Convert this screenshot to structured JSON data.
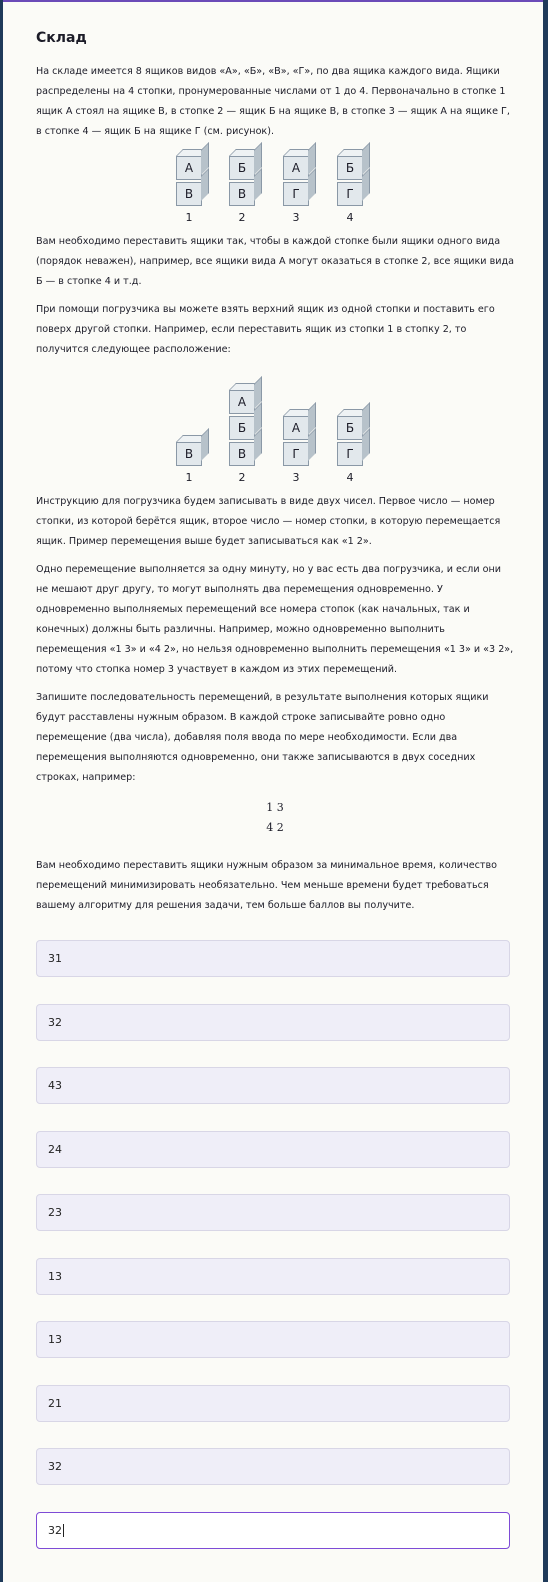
{
  "page": {
    "title": "Склад",
    "p1": "На складе имеется 8 ящиков видов «А», «Б», «В», «Г», по два ящика каждого вида. Ящики распределены на 4 стопки, пронумерованные числами от 1 до 4. Первоначально в стопке 1 ящик А стоял на ящике В, в стопке 2 — ящик Б на ящике В, в стопке 3 — ящик А на ящике Г, в стопке 4 — ящик Б на ящике Г (см. рисунок).",
    "p2": "Вам необходимо переставить ящики так, чтобы в каждой стопке были ящики одного вида (порядок неважен), например, все ящики вида А могут оказаться в стопке 2, все ящики вида Б — в стопке 4 и т.д.",
    "p3": "При помощи погрузчика вы можете взять верхний ящик из одной стопки и поставить его поверх другой стопки. Например, если переставить ящик из стопки 1 в стопку 2, то получится следующее расположение:",
    "p4": "Инструкцию для погрузчика будем записывать в виде двух чисел. Первое число — номер стопки, из которой берётся ящик, второе число — номер стопки, в которую перемещается ящик. Пример перемещения выше будет записываться как «1 2».",
    "p5": "Одно перемещение выполняется за одну минуту, но у вас есть два погрузчика, и если они не мешают друг другу, то могут выполнять два перемещения одновременно. У одновременно выполняемых перемещений все номера стопок (как начальных, так и конечных) должны быть различны. Например, можно одновременно выполнить перемещения «1 3» и «4 2», но нельзя одновременно выполнить перемещения «1 3» и «3 2», потому что стопка номер 3 участвует в каждом из этих перемещений.",
    "p6": "Запишите последовательность перемещений, в результате выполнения которых ящики будут расставлены нужным образом. В каждой строке записывайте ровно одно перемещение (два числа), добавляя поля ввода по мере необходимости. Если два перемещения выполняются одновременно, они также записываются в двух соседних строках, например:",
    "example_line1": "1 3",
    "example_line2": "4 2",
    "p7": "Вам необходимо переставить ящики нужным образом за минимальное время, количество перемещений минимизировать необязательно. Чем меньше времени будет требоваться вашему алгоритму для решения задачи, тем больше баллов вы получите."
  },
  "figure1": {
    "stacks": [
      {
        "label": "1",
        "boxes": [
          "А",
          "В"
        ]
      },
      {
        "label": "2",
        "boxes": [
          "Б",
          "В"
        ]
      },
      {
        "label": "3",
        "boxes": [
          "А",
          "Г"
        ]
      },
      {
        "label": "4",
        "boxes": [
          "Б",
          "Г"
        ]
      }
    ]
  },
  "figure2": {
    "stacks": [
      {
        "label": "1",
        "boxes": [
          "В"
        ]
      },
      {
        "label": "2",
        "boxes": [
          "А",
          "Б",
          "В"
        ]
      },
      {
        "label": "3",
        "boxes": [
          "А",
          "Г"
        ]
      },
      {
        "label": "4",
        "boxes": [
          "Б",
          "Г"
        ]
      }
    ]
  },
  "answers": [
    "31",
    "32",
    "43",
    "24",
    "23",
    "13",
    "13",
    "21",
    "32",
    "32"
  ],
  "colors": {
    "accent": "#7e4bd6",
    "input_bg": "#efeef8",
    "page_bg": "#fbfbf7",
    "outer_bg": "#1f3a5a"
  }
}
